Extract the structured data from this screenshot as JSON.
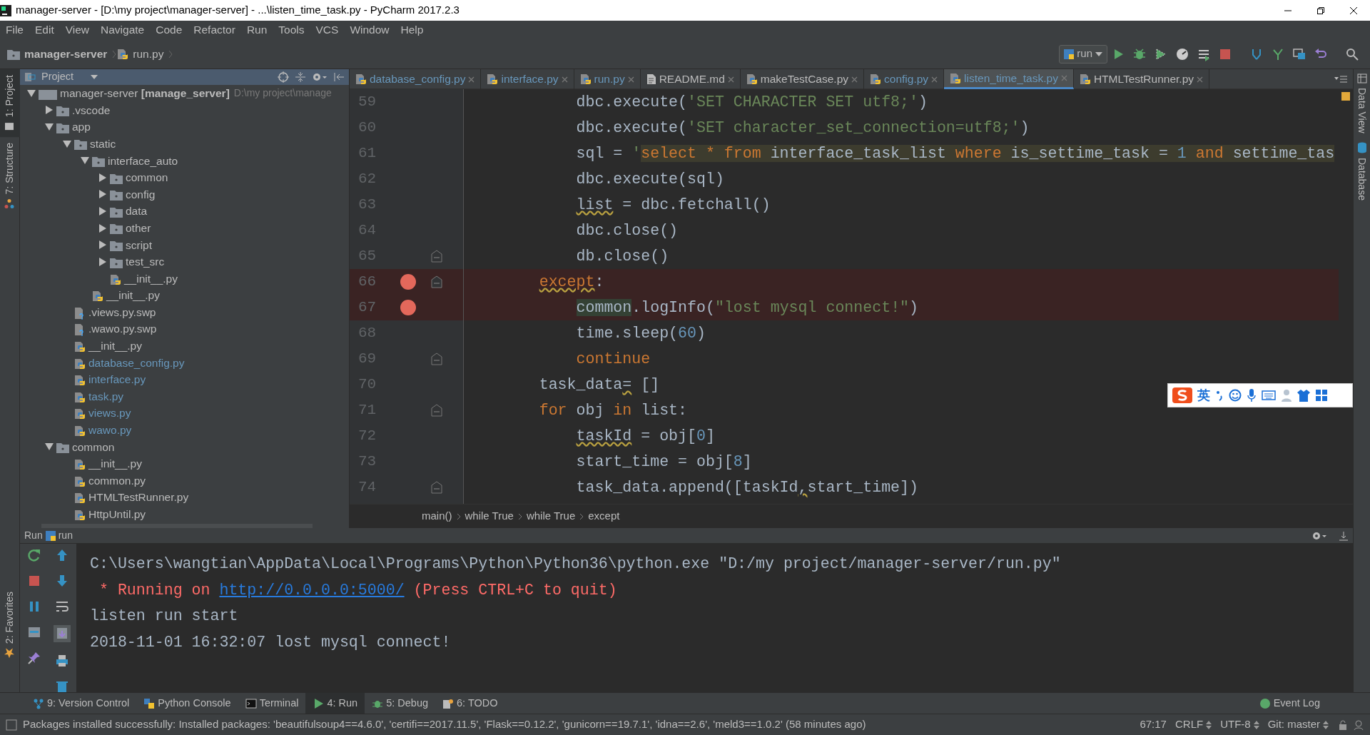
{
  "window": {
    "title": "manager-server - [D:\\my project\\manager-server] - ...\\listen_time_task.py - PyCharm 2017.2.3"
  },
  "menu": [
    "File",
    "Edit",
    "View",
    "Navigate",
    "Code",
    "Refactor",
    "Run",
    "Tools",
    "VCS",
    "Window",
    "Help"
  ],
  "navigation": {
    "crumbs": [
      {
        "label": "manager-server",
        "kind": "folder"
      },
      {
        "label": "run.py",
        "kind": "python"
      }
    ]
  },
  "run_configuration": {
    "label": "run"
  },
  "left_tool_windows": [
    {
      "label": "1: Project",
      "kind": "project",
      "selected": true
    },
    {
      "label": "7: Structure",
      "kind": "structure",
      "selected": false
    }
  ],
  "favorites": {
    "label": "2: Favorites"
  },
  "right_tool_windows": [
    "Data View",
    "Database"
  ],
  "project": {
    "title": "Project",
    "root": {
      "label": "manager-server **[manage_server]**",
      "path": "D:\\my project\\manage",
      "expanded": true,
      "children": [
        {
          "label": ".vscode",
          "kind": "folder",
          "expanded": false
        },
        {
          "label": "app",
          "kind": "folder",
          "expanded": true,
          "children": [
            {
              "label": "static",
              "kind": "folder",
              "expanded": true,
              "children": [
                {
                  "label": "interface_auto",
                  "kind": "folder",
                  "expanded": true,
                  "children": [
                    {
                      "label": "common",
                      "kind": "folder",
                      "expanded": false
                    },
                    {
                      "label": "config",
                      "kind": "folder",
                      "expanded": false
                    },
                    {
                      "label": "data",
                      "kind": "folder",
                      "expanded": false
                    },
                    {
                      "label": "other",
                      "kind": "folder",
                      "expanded": false
                    },
                    {
                      "label": "script",
                      "kind": "folder",
                      "expanded": false
                    },
                    {
                      "label": "test_src",
                      "kind": "folder",
                      "expanded": false
                    },
                    {
                      "label": "__init__.py",
                      "kind": "python",
                      "modified": false
                    }
                  ]
                },
                {
                  "label": "__init__.py",
                  "kind": "python",
                  "modified": false
                }
              ]
            },
            {
              "label": ".views.py.swp",
              "kind": "unknown",
              "modified": false
            },
            {
              "label": ".wawo.py.swp",
              "kind": "unknown",
              "modified": false
            },
            {
              "label": "__init__.py",
              "kind": "python",
              "modified": false
            },
            {
              "label": "database_config.py",
              "kind": "python",
              "modified": true
            },
            {
              "label": "interface.py",
              "kind": "python",
              "modified": true
            },
            {
              "label": "task.py",
              "kind": "python",
              "modified": true
            },
            {
              "label": "views.py",
              "kind": "python",
              "modified": true
            },
            {
              "label": "wawo.py",
              "kind": "python",
              "modified": true
            }
          ]
        },
        {
          "label": "common",
          "kind": "folder",
          "expanded": true,
          "children": [
            {
              "label": "__init__.py",
              "kind": "python",
              "modified": false
            },
            {
              "label": "common.py",
              "kind": "python",
              "modified": false
            },
            {
              "label": "HTMLTestRunner.py",
              "kind": "python",
              "modified": false
            },
            {
              "label": "HttpUntil.py",
              "kind": "python",
              "modified": false
            }
          ]
        }
      ]
    }
  },
  "editor": {
    "tabs": [
      {
        "label": "database_config.py",
        "kind": "python",
        "modified": true,
        "selected": false
      },
      {
        "label": "interface.py",
        "kind": "python",
        "modified": true,
        "selected": false
      },
      {
        "label": "run.py",
        "kind": "python",
        "modified": true,
        "selected": false
      },
      {
        "label": "README.md",
        "kind": "markdown",
        "modified": false,
        "selected": false
      },
      {
        "label": "makeTestCase.py",
        "kind": "python",
        "modified": false,
        "selected": false
      },
      {
        "label": "config.py",
        "kind": "python",
        "modified": true,
        "selected": false
      },
      {
        "label": "listen_time_task.py",
        "kind": "python",
        "modified": true,
        "selected": true
      },
      {
        "label": "HTMLTestRunner.py",
        "kind": "python",
        "modified": false,
        "selected": false
      }
    ],
    "lines": [
      {
        "number": "59",
        "fold": false,
        "breakpoint": false,
        "tokens": [
          {
            "kind": "plain",
            "text": "            dbc.execute("
          },
          {
            "kind": "string",
            "text": "'SET CHARACTER SET utf8;'"
          },
          {
            "kind": "plain",
            "text": ")"
          }
        ]
      },
      {
        "number": "60",
        "fold": false,
        "breakpoint": false,
        "tokens": [
          {
            "kind": "plain",
            "text": "            dbc.execute("
          },
          {
            "kind": "string",
            "text": "'SET character_set_connection=utf8;'"
          },
          {
            "kind": "plain",
            "text": ")"
          }
        ]
      },
      {
        "number": "61",
        "fold": false,
        "breakpoint": false,
        "tokens": [
          {
            "kind": "plain",
            "text": "            sql = "
          },
          {
            "kind": "string",
            "text": "'"
          },
          {
            "kind": "sql-keyword",
            "text": "select * from"
          },
          {
            "kind": "sql",
            "text": " interface_task_list "
          },
          {
            "kind": "sql-keyword",
            "text": "where"
          },
          {
            "kind": "sql",
            "text": " is_settime_task = "
          },
          {
            "kind": "sql-number",
            "text": "1"
          },
          {
            "kind": "sql-keyword",
            "text": " and"
          },
          {
            "kind": "sql",
            "text": " settime_tas"
          }
        ]
      },
      {
        "number": "62",
        "fold": false,
        "breakpoint": false,
        "tokens": [
          {
            "kind": "plain",
            "text": "            dbc.execute(sql)"
          }
        ]
      },
      {
        "number": "63",
        "fold": false,
        "breakpoint": false,
        "tokens": [
          {
            "kind": "warning",
            "text": "            list"
          },
          {
            "kind": "plain",
            "text": " = dbc.fetchall()"
          }
        ]
      },
      {
        "number": "64",
        "fold": false,
        "breakpoint": false,
        "tokens": [
          {
            "kind": "plain",
            "text": "            dbc.close()"
          }
        ]
      },
      {
        "number": "65",
        "fold": true,
        "breakpoint": false,
        "tokens": [
          {
            "kind": "plain",
            "text": "            db.close()"
          }
        ]
      },
      {
        "number": "66",
        "fold": true,
        "breakpoint": true,
        "tokens": [
          {
            "kind": "keyword-warning",
            "text": "        except"
          },
          {
            "kind": "plain",
            "text": ":"
          }
        ]
      },
      {
        "number": "67",
        "fold": false,
        "breakpoint": true,
        "tokens": [
          {
            "kind": "highlight",
            "text": "            common"
          },
          {
            "kind": "plain",
            "text": ".logInfo("
          },
          {
            "kind": "string",
            "text": "\"lost mysql connect!\""
          },
          {
            "kind": "plain",
            "text": ")"
          }
        ]
      },
      {
        "number": "68",
        "fold": false,
        "breakpoint": false,
        "tokens": [
          {
            "kind": "plain",
            "text": "            time.sleep("
          },
          {
            "kind": "number",
            "text": "60"
          },
          {
            "kind": "plain",
            "text": ")"
          }
        ]
      },
      {
        "number": "69",
        "fold": true,
        "breakpoint": false,
        "tokens": [
          {
            "kind": "keyword",
            "text": "            continue"
          }
        ]
      },
      {
        "number": "70",
        "fold": false,
        "breakpoint": false,
        "tokens": [
          {
            "kind": "plain",
            "text": "        task_data"
          },
          {
            "kind": "warning",
            "text": "="
          },
          {
            "kind": "plain",
            "text": " []"
          }
        ]
      },
      {
        "number": "71",
        "fold": true,
        "breakpoint": false,
        "tokens": [
          {
            "kind": "keyword",
            "text": "        for"
          },
          {
            "kind": "plain",
            "text": " obj "
          },
          {
            "kind": "keyword",
            "text": "in"
          },
          {
            "kind": "plain",
            "text": " list:"
          }
        ]
      },
      {
        "number": "72",
        "fold": false,
        "breakpoint": false,
        "tokens": [
          {
            "kind": "warning",
            "text": "            taskId"
          },
          {
            "kind": "plain",
            "text": " = obj["
          },
          {
            "kind": "number",
            "text": "0"
          },
          {
            "kind": "plain",
            "text": "]"
          }
        ]
      },
      {
        "number": "73",
        "fold": false,
        "breakpoint": false,
        "tokens": [
          {
            "kind": "plain",
            "text": "            start_time = obj["
          },
          {
            "kind": "number",
            "text": "8"
          },
          {
            "kind": "plain",
            "text": "]"
          }
        ]
      },
      {
        "number": "74",
        "fold": true,
        "breakpoint": false,
        "tokens": [
          {
            "kind": "plain",
            "text": "            task_data.append([taskId"
          },
          {
            "kind": "warning",
            "text": ","
          },
          {
            "kind": "plain",
            "text": "start_time])"
          }
        ]
      }
    ],
    "breadcrumbs": [
      "main()",
      "while True",
      "while True",
      "except"
    ]
  },
  "ime_bar": {
    "mode": "英"
  },
  "run_panel": {
    "title": "Run",
    "configuration": "run",
    "lines": [
      {
        "tokens": [
          {
            "kind": "plain",
            "text": "C:\\Users\\wangtian\\AppData\\Local\\Programs\\Python\\Python36\\python.exe \"D:/my project/manager-server/run.py\""
          }
        ]
      },
      {
        "tokens": [
          {
            "kind": "error",
            "text": " * Running on "
          },
          {
            "kind": "link",
            "text": "http://0.0.0.0:5000/"
          },
          {
            "kind": "error",
            "text": " (Press CTRL+C to quit)"
          }
        ]
      },
      {
        "tokens": [
          {
            "kind": "plain",
            "text": "listen run start"
          }
        ]
      },
      {
        "tokens": [
          {
            "kind": "plain",
            "text": "2018-11-01 16:32:07 lost mysql connect!"
          }
        ]
      }
    ]
  },
  "tool_tabs": [
    {
      "label": "9: Version Control",
      "kind": "vcs",
      "selected": false
    },
    {
      "label": "Python Console",
      "kind": "python",
      "selected": false
    },
    {
      "label": "Terminal",
      "kind": "terminal",
      "selected": false
    },
    {
      "label": "4: Run",
      "kind": "run",
      "selected": true
    },
    {
      "label": "5: Debug",
      "kind": "debug",
      "selected": false
    },
    {
      "label": "6: TODO",
      "kind": "todo",
      "selected": false
    }
  ],
  "event_log": "Event Log",
  "status_bar": {
    "message": "Packages installed successfully: Installed packages: 'beautifulsoup4==4.6.0', 'certifi==2017.11.5', 'Flask==0.12.2', 'gunicorn==19.7.1', 'idna==2.6', 'meld3==1.0.2' (58 minutes ago)",
    "position": "67:17",
    "line_separator": "CRLF",
    "encoding": "UTF-8",
    "vcs": "Git: master"
  }
}
